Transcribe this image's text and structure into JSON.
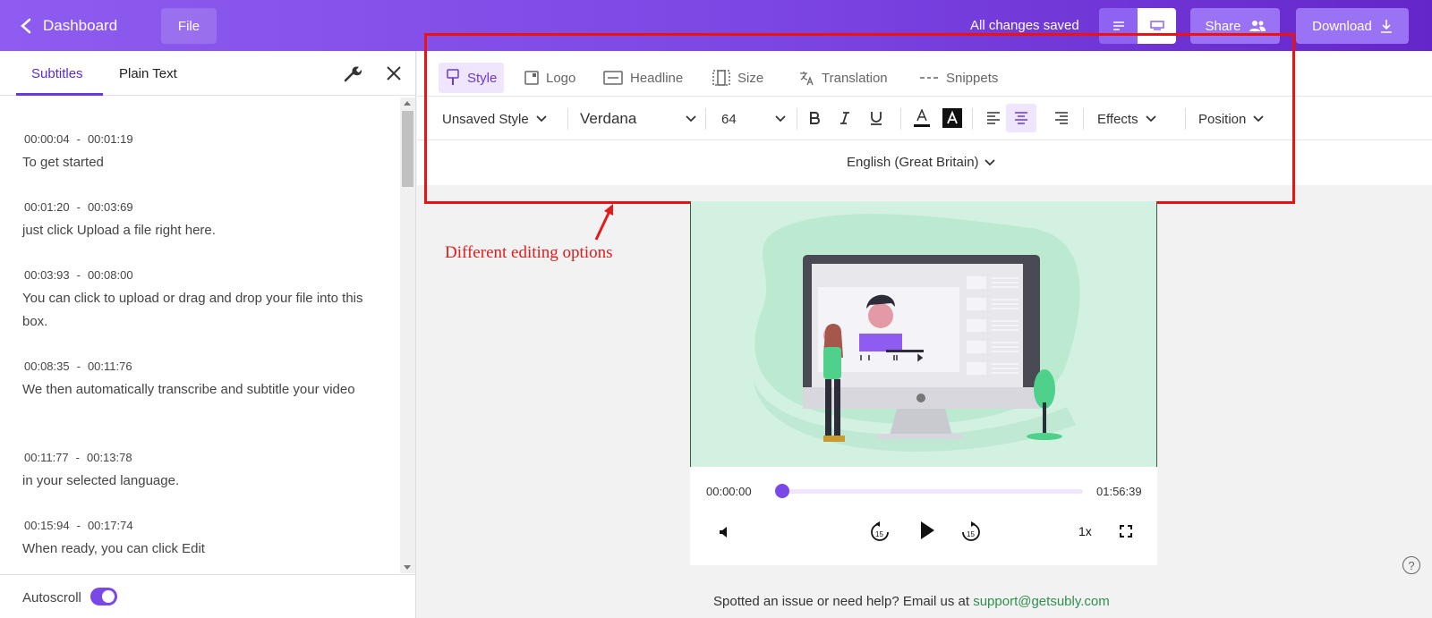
{
  "topbar": {
    "back_label": "Dashboard",
    "file_label": "File",
    "status": "All changes saved",
    "share_label": "Share",
    "download_label": "Download"
  },
  "left_panel": {
    "tabs": [
      {
        "label": "Subtitles"
      },
      {
        "label": "Plain Text"
      }
    ],
    "cues": [
      {
        "start": "00:00:04",
        "end": "00:01:19",
        "text": "To get started"
      },
      {
        "start": "00:01:20",
        "end": "00:03:69",
        "text": "just click Upload a file right here."
      },
      {
        "start": "00:03:93",
        "end": "00:08:00",
        "text": "You can click to upload or drag and drop your file into this box."
      },
      {
        "start": "00:08:35",
        "end": "00:11:76",
        "text": "We then automatically transcribe and subtitle your video"
      },
      {
        "start": "00:11:77",
        "end": "00:13:78",
        "text": "in your selected language."
      },
      {
        "start": "00:15:94",
        "end": "00:17:74",
        "text": "When ready, you can click Edit"
      }
    ],
    "autoscroll_label": "Autoscroll",
    "autoscroll_on": true
  },
  "editor": {
    "tabs": [
      {
        "label": "Style",
        "icon": "brush-icon"
      },
      {
        "label": "Logo",
        "icon": "logo-icon"
      },
      {
        "label": "Headline",
        "icon": "headline-icon"
      },
      {
        "label": "Size",
        "icon": "size-icon"
      },
      {
        "label": "Translation",
        "icon": "translation-icon"
      },
      {
        "label": "Snippets",
        "icon": "snippets-icon"
      }
    ],
    "style_preset": "Unsaved Style",
    "font": "Verdana",
    "font_size": "64",
    "effects_label": "Effects",
    "position_label": "Position",
    "language": "English (Great Britain)",
    "accent": "#6a38d8"
  },
  "annotation": {
    "text": "Different editing options",
    "color": "#e21c1c"
  },
  "player": {
    "current_time": "00:00:00",
    "duration": "01:56:39",
    "speed": "1x",
    "progress": 0
  },
  "footer": {
    "text": "Spotted an issue or need help? Email us at",
    "email": "support@getsubly.com"
  },
  "help": {
    "glyph": "?"
  }
}
